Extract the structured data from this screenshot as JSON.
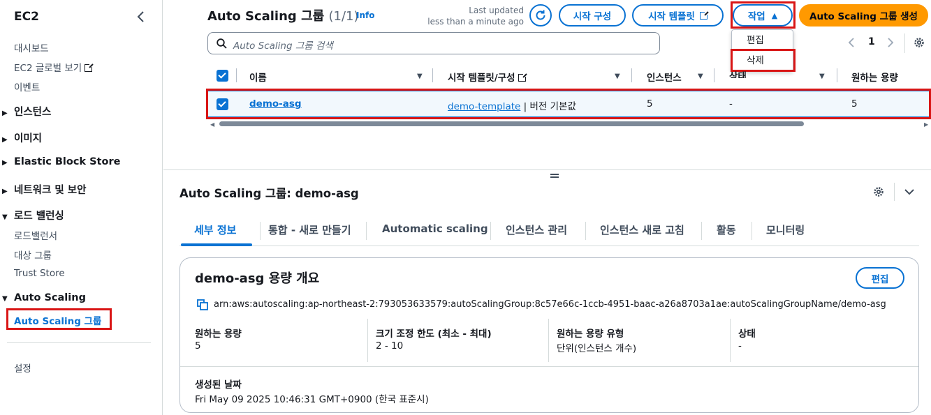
{
  "sidebar": {
    "title": "EC2",
    "links_top": [
      "대시보드",
      "EC2 글로벌 보기",
      "이벤트"
    ],
    "sections": [
      "인스턴스",
      "이미지",
      "Elastic Block Store",
      "네트워크 및 보안",
      "로드 밸런싱"
    ],
    "lb_items": [
      "로드밸런서",
      "대상 그룹",
      "Trust Store"
    ],
    "autoscaling_section": "Auto Scaling",
    "autoscaling_item": "Auto Scaling 그룹",
    "settings": "설정"
  },
  "header": {
    "title": "Auto Scaling 그룹",
    "count": "(1/1)",
    "info": "Info",
    "updated_line1": "Last updated",
    "updated_line2": "less than a minute ago",
    "btn_launch_config": "시작 구성",
    "btn_launch_template": "시작 템플릿",
    "btn_actions": "작업",
    "btn_create": "Auto Scaling 그룹 생성",
    "search_placeholder": "Auto Scaling 그룹 검색",
    "page": "1"
  },
  "actions_menu": [
    "편집",
    "삭제"
  ],
  "table": {
    "columns": [
      "이름",
      "시작 템플릿/구성",
      "인스턴스",
      "상태",
      "원하는 용량"
    ],
    "rows": [
      {
        "name": "demo-asg",
        "template": "demo-template",
        "template_suffix": "| 버전 기본값",
        "instances": "5",
        "status": "-",
        "desired": "5"
      }
    ]
  },
  "detail": {
    "title": "Auto Scaling 그룹: demo-asg",
    "tabs": [
      "세부 정보",
      "통합 - 새로 만들기",
      "Automatic scaling",
      "인스턴스 관리",
      "인스턴스 새로 고침",
      "활동",
      "모니터링"
    ],
    "card": {
      "title": "demo-asg 용량 개요",
      "edit": "편집",
      "arn": "arn:aws:autoscaling:ap-northeast-2:793053633579:autoScalingGroup:8c57e66c-1ccb-4951-baac-a26a8703a1ae:autoScalingGroupName/demo-asg",
      "fields": [
        {
          "label": "원하는 용량",
          "value": "5"
        },
        {
          "label": "크기 조정 한도 (최소 - 최대)",
          "value": "2 - 10"
        },
        {
          "label": "원하는 용량 유형",
          "value": "단위(인스턴스 개수)"
        },
        {
          "label": "상태",
          "value": "-"
        }
      ],
      "created_label": "생성된 날짜",
      "created_value": "Fri May 09 2025 10:46:31 GMT+0900 (한국 표준시)"
    }
  },
  "colors": {
    "accent": "#0972d3",
    "primary": "#ff9900",
    "highlight": "#d91515"
  }
}
